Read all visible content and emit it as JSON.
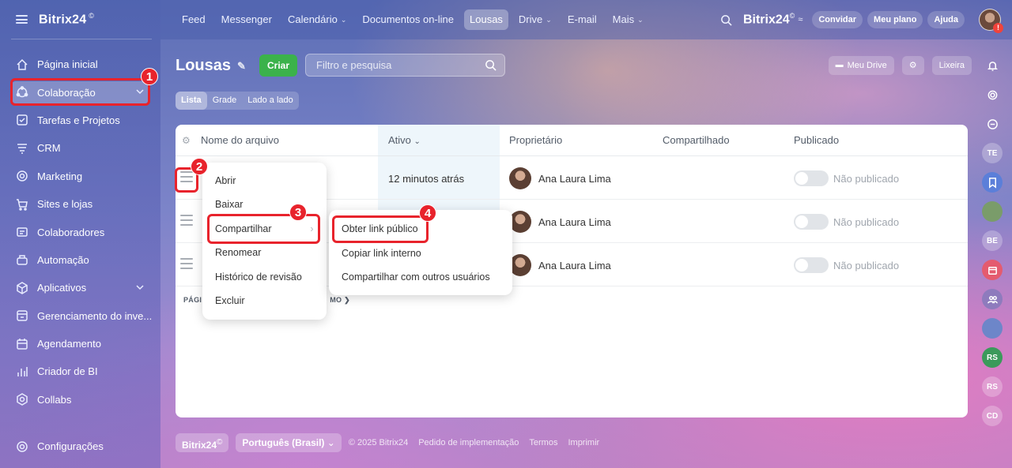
{
  "app": {
    "name": "Bitrix24",
    "mark": "©"
  },
  "sidebar": {
    "items": [
      {
        "label": "Página inicial",
        "icon": "home-icon",
        "name": "sidebar-item-home"
      },
      {
        "label": "Colaboração",
        "icon": "collaboration-icon",
        "name": "sidebar-item-colaboracao",
        "active": true
      },
      {
        "label": "Tarefas e Projetos",
        "icon": "tasks-icon",
        "name": "sidebar-item-tarefas"
      },
      {
        "label": "CRM",
        "icon": "crm-icon",
        "name": "sidebar-item-crm"
      },
      {
        "label": "Marketing",
        "icon": "marketing-icon",
        "name": "sidebar-item-marketing"
      },
      {
        "label": "Sites e lojas",
        "icon": "cart-icon",
        "name": "sidebar-item-sites"
      },
      {
        "label": "Colaboradores",
        "icon": "people-icon",
        "name": "sidebar-item-colaboradores"
      },
      {
        "label": "Automação",
        "icon": "automation-icon",
        "name": "sidebar-item-automacao"
      },
      {
        "label": "Aplicativos",
        "icon": "cube-icon",
        "name": "sidebar-item-aplicativos"
      },
      {
        "label": "Gerenciamento do inve...",
        "icon": "inventory-icon",
        "name": "sidebar-item-inventario"
      },
      {
        "label": "Agendamento",
        "icon": "calendar-icon",
        "name": "sidebar-item-agendamento"
      },
      {
        "label": "Criador de BI",
        "icon": "bars-icon",
        "name": "sidebar-item-bi"
      },
      {
        "label": "Collabs",
        "icon": "hexagon-icon",
        "name": "sidebar-item-collabs"
      }
    ],
    "settings_label": "Configurações"
  },
  "topnav": {
    "items": [
      {
        "label": "Feed"
      },
      {
        "label": "Messenger"
      },
      {
        "label": "Calendário",
        "dropdown": "⌄"
      },
      {
        "label": "Documentos on-line"
      },
      {
        "label": "Lousas",
        "active": true
      },
      {
        "label": "Drive",
        "dropdown": "⌄"
      },
      {
        "label": "E-mail"
      },
      {
        "label": "Mais",
        "dropdown": "⌄"
      }
    ],
    "logo": "Bitrix24",
    "invite_label": "Convidar",
    "plan_label": "Meu plano",
    "help_label": "Ajuda"
  },
  "page": {
    "title": "Lousas",
    "create_label": "Criar",
    "filter_placeholder": "Filtro e pesquisa",
    "my_drive_label": "Meu Drive",
    "trash_label": "Lixeira",
    "view_tabs": [
      "Lista",
      "Grade",
      "Lado a lado"
    ]
  },
  "table": {
    "columns": {
      "name": "Nome do arquivo",
      "active": "Ativo",
      "owner": "Proprietário",
      "shared": "Compartilhado",
      "published": "Publicado"
    },
    "rows": [
      {
        "active": "12 minutos atrás",
        "owner": "Ana Laura Lima",
        "published": "Não publicado"
      },
      {
        "active": "",
        "owner": "Ana Laura Lima",
        "published": "Não publicado"
      },
      {
        "active": "",
        "owner": "Ana Laura Lima",
        "published": "Não publicado"
      }
    ],
    "pager_left": "PÁGI",
    "pager_right": "MO ❯"
  },
  "context_menu": {
    "items": [
      "Abrir",
      "Baixar",
      "Compartilhar",
      "Renomear",
      "Histórico de revisão",
      "Excluir"
    ]
  },
  "submenu": {
    "items": [
      "Obter link público",
      "Copiar link interno",
      "Compartilhar com outros usuários"
    ]
  },
  "badges": [
    "1",
    "2",
    "3",
    "4"
  ],
  "rail": [
    "TE",
    "BE",
    "RS",
    "RS",
    "CD"
  ],
  "footer": {
    "brand": "Bitrix24",
    "language": "Português (Brasil)",
    "links": [
      "© 2025 Bitrix24",
      "Pedido de implementação",
      "Termos",
      "Imprimir"
    ]
  },
  "colors": {
    "accent_red": "#e8232c",
    "create_green": "#3bb24b"
  }
}
